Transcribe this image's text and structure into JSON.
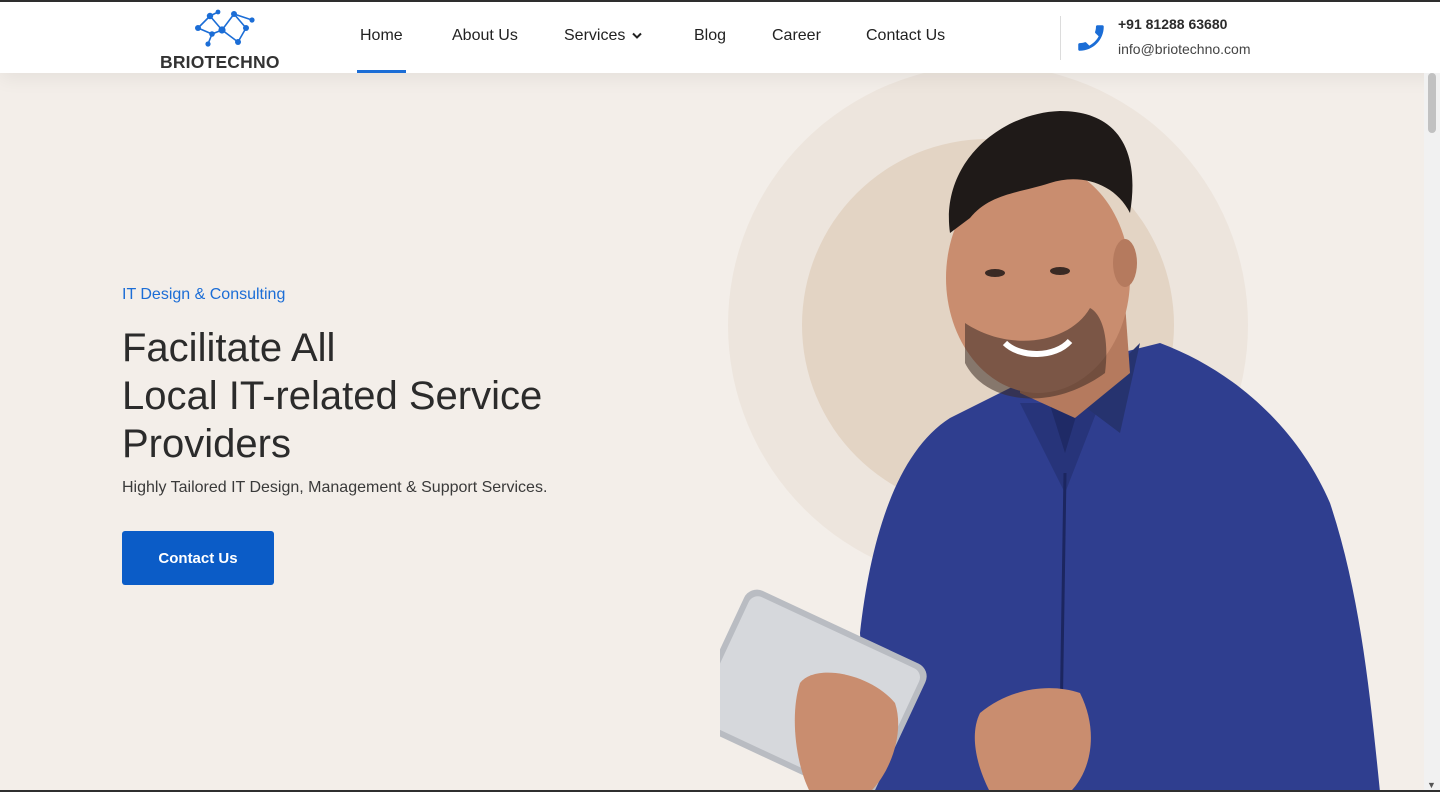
{
  "brand": {
    "name": "BRIOTECHNO",
    "logo_icon": "network-nodes-icon"
  },
  "nav": {
    "items": [
      {
        "label": "Home",
        "active": true
      },
      {
        "label": "About Us"
      },
      {
        "label": "Services",
        "dropdown": true
      },
      {
        "label": "Blog"
      },
      {
        "label": "Career"
      },
      {
        "label": "Contact Us"
      }
    ]
  },
  "contact": {
    "phone": "+91 81288 63680",
    "email": "info@briotechno.com",
    "icon": "phone-icon"
  },
  "hero": {
    "subtitle": "IT Design & Consulting",
    "title_lines": [
      "Facilitate All",
      "Local IT-related Service",
      "Providers"
    ],
    "description": "Highly Tailored IT Design, Management & Support Services.",
    "cta_label": "Contact Us",
    "image": "man-holding-tablet-photo"
  },
  "colors": {
    "accent": "#1b6dd6",
    "button": "#0b5cc7",
    "hero_bg": "#f3eee9",
    "shirt": "#2f3e8f"
  }
}
